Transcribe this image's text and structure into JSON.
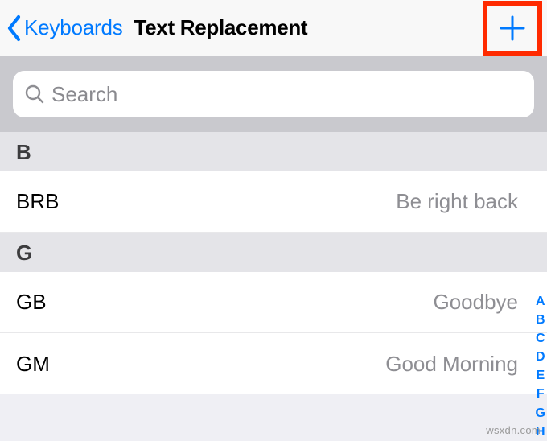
{
  "nav": {
    "back_label": "Keyboards",
    "title": "Text Replacement"
  },
  "search": {
    "placeholder": "Search"
  },
  "sections": [
    {
      "letter": "B",
      "rows": [
        {
          "shortcut": "BRB",
          "phrase": "Be right back"
        }
      ]
    },
    {
      "letter": "G",
      "rows": [
        {
          "shortcut": "GB",
          "phrase": "Goodbye"
        },
        {
          "shortcut": "GM",
          "phrase": "Good Morning"
        }
      ]
    }
  ],
  "index_bar": [
    "A",
    "B",
    "C",
    "D",
    "E",
    "F",
    "G",
    "H"
  ],
  "watermark": "wsxdn.com"
}
